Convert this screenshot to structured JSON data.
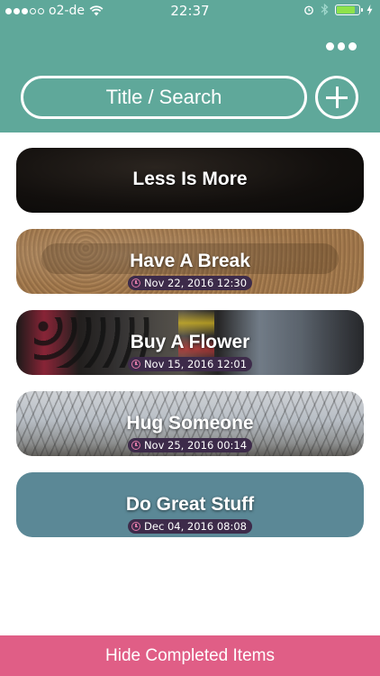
{
  "status_bar": {
    "carrier": "o2-de",
    "time": "22:37",
    "battery_color": "#8ee24a"
  },
  "header": {
    "background_color": "#5fa89a",
    "search_placeholder": "Title / Search",
    "more_icon": "ellipsis-icon",
    "add_icon": "plus-circle-icon"
  },
  "items": [
    {
      "title": "Less Is More",
      "date": ""
    },
    {
      "title": "Have A Break",
      "date": "Nov 22, 2016 12:30"
    },
    {
      "title": "Buy A Flower",
      "date": "Nov 15, 2016 12:01"
    },
    {
      "title": "Hug Someone",
      "date": "Nov 25, 2016 00:14"
    },
    {
      "title": "Do Great Stuff",
      "date": "Dec 04, 2016 08:08"
    }
  ],
  "footer": {
    "label": "Hide Completed Items",
    "background_color": "#e05e86"
  }
}
